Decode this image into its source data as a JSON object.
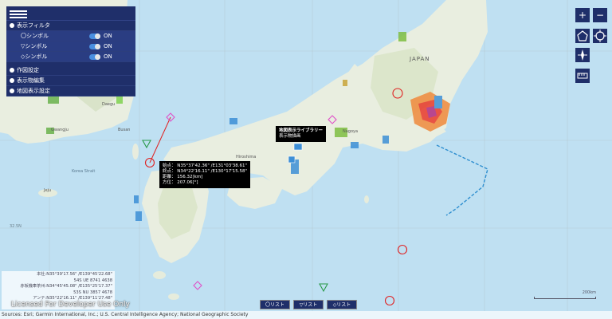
{
  "menu": {
    "display_filter": "表示フィルタ",
    "filters": [
      {
        "label": "〇シンボル",
        "state": "ON"
      },
      {
        "label": "▽シンボル",
        "state": "ON"
      },
      {
        "label": "◇シンボル",
        "state": "ON"
      }
    ],
    "drawing_settings": "作図設定",
    "display_edit": "表示物編集",
    "map_display_settings": "地図表示設定"
  },
  "tools": {
    "zoom_in": "+",
    "zoom_out": "−"
  },
  "popup_library": {
    "line1": "地図表示ライブラリー",
    "line2": "表示物描画"
  },
  "popup_measure": {
    "start": "始点： N35°37'42.36\" /E131°03'38.61\"",
    "end": "終点： N34°22'16.11\" /E130°17'15.58\"",
    "distance": "距離： 156.32[km]",
    "bearing": "方位： 207.06[°]"
  },
  "coords": [
    "本社:N35°39'17.56\" /E139°45'22.68\"",
    "54S UE 8741 4638",
    "赤坂機車茶州:N34°45'45.08\" /E135°25'17.37\"",
    "53S NU 3857 4678",
    "アンテ:N35°22'16.11\" /E139°11'27.48\""
  ],
  "licensed": "Licensed For Developer Use Only",
  "list_buttons": [
    "〇リスト",
    "▽リスト",
    "◇リスト"
  ],
  "attribution": "Sources: Esri; Garmin International, Inc.; U.S. Central Intelligence Agency; National Geographic Society",
  "scale_label": "200km",
  "map_labels": {
    "japan": "JAPAN",
    "daegu": "Daegu",
    "busan": "Busan",
    "gwangju": "Gwangju",
    "jeju": "Jeju",
    "hiroshima": "Hiroshima",
    "nagoya": "Nagoya",
    "korea_strait": "Korea Strait",
    "lat_label": "32.5N"
  }
}
